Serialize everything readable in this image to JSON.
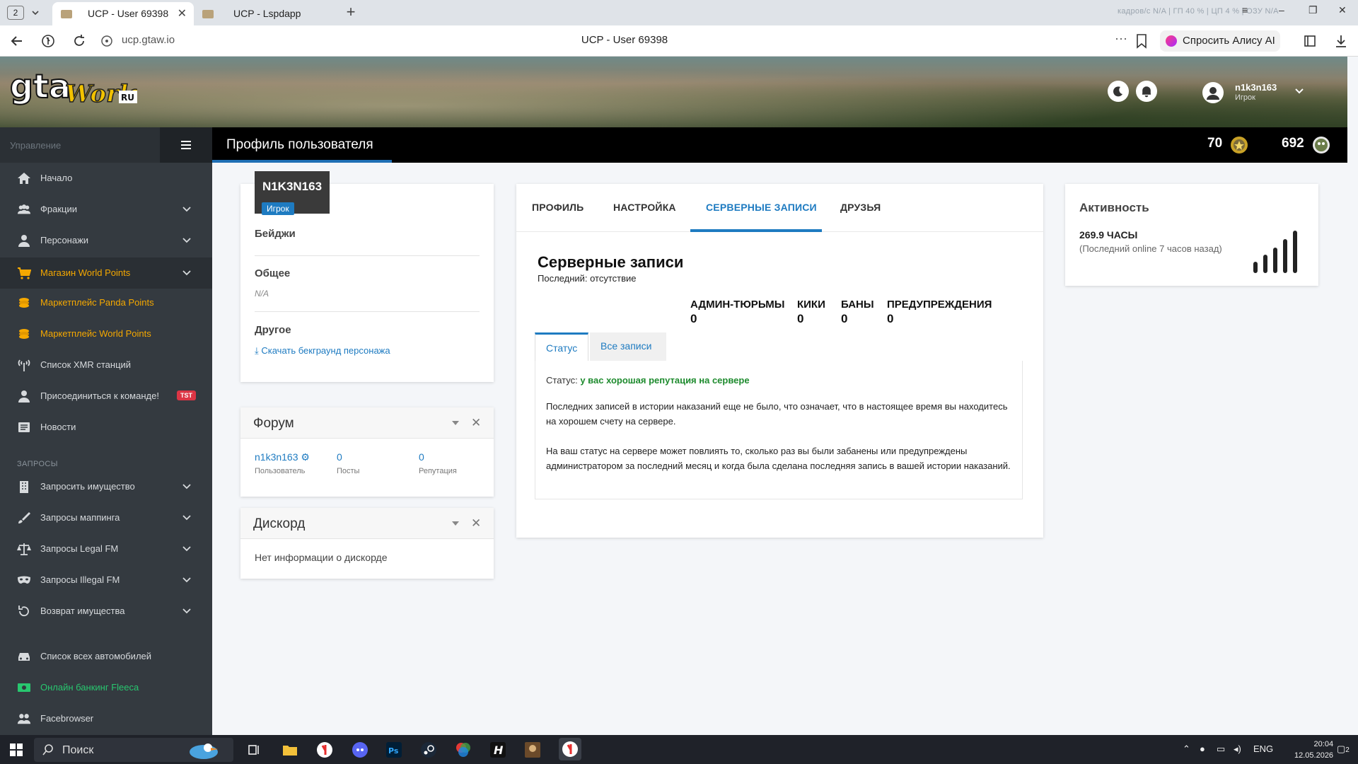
{
  "browser": {
    "tab_count": "2",
    "tabs": [
      {
        "title": "UCP - User 69398"
      },
      {
        "title": "UCP - Lspdapp"
      }
    ],
    "sys_overlay": "кадров/с  N/A   |  ГП  40 %  |  ЦП  4 %  |  ОЗУ  N/A",
    "url": "ucp.gtaw.io",
    "page_title": "UCP - User 69398",
    "alice_label": "Спросить Алису AI"
  },
  "header": {
    "logo_text": "gtaWorld.ru",
    "user_name": "n1k3n163",
    "user_role": "Игрок"
  },
  "sidebar": {
    "section_label": "Управление",
    "items": [
      {
        "label": "Начало",
        "icon": "home-icon"
      },
      {
        "label": "Фракции",
        "icon": "users-icon"
      },
      {
        "label": "Персонажи",
        "icon": "user-icon"
      },
      {
        "label": "Магазин World Points",
        "icon": "cart-icon"
      },
      {
        "label": "Маркетплейс Panda Points",
        "icon": "coins-icon"
      },
      {
        "label": "Маркетплейс World Points",
        "icon": "coins-icon"
      },
      {
        "label": "Список XMR станций",
        "icon": "antenna-icon"
      },
      {
        "label": "Присоединиться к команде!",
        "icon": "user-plus-icon",
        "badge": "TST"
      },
      {
        "label": "Новости",
        "icon": "newspaper-icon"
      }
    ],
    "group_label": "ЗАПРОСЫ",
    "requests": [
      {
        "label": "Запросить имущество",
        "icon": "building-icon"
      },
      {
        "label": "Запросы маппинга",
        "icon": "brush-icon"
      },
      {
        "label": "Запросы Legal FM",
        "icon": "scale-icon"
      },
      {
        "label": "Запросы Illegal FM",
        "icon": "mask-icon"
      },
      {
        "label": "Возврат имущества",
        "icon": "undo-icon"
      }
    ],
    "bottom": [
      {
        "label": "Список всех автомобилей",
        "icon": "car-icon"
      },
      {
        "label": "Онлайн банкинг Fleeca",
        "icon": "money-icon"
      },
      {
        "label": "Facebrowser",
        "icon": "users-icon"
      }
    ]
  },
  "titlebar": {
    "title": "Профиль пользователя",
    "points_1": "70",
    "points_2": "692"
  },
  "profile": {
    "nickname": "N1K3N163",
    "role": "Игрок",
    "badges_label": "Бейджи",
    "general_label": "Общее",
    "general_value": "N/A",
    "other_label": "Другое",
    "download_link": "Скачать бекграунд персонажа"
  },
  "forum": {
    "title": "Форум",
    "username": "n1k3n163",
    "username_label": "Пользователь",
    "posts": "0",
    "posts_label": "Посты",
    "reputation": "0",
    "reputation_label": "Репутация"
  },
  "discord": {
    "title": "Дискорд",
    "text": "Нет информации о дискорде"
  },
  "records": {
    "tabs": [
      "ПРОФИЛЬ",
      "НАСТРОЙКА",
      "СЕРВЕРНЫЕ ЗАПИСИ",
      "ДРУЗЬЯ"
    ],
    "title": "Серверные записи",
    "subtitle": "Последний: отсутствие",
    "stats": [
      {
        "label": "АДМИН-ТЮРЬМЫ",
        "value": "0"
      },
      {
        "label": "КИКИ",
        "value": "0"
      },
      {
        "label": "БАНЫ",
        "value": "0"
      },
      {
        "label": "ПРЕДУПРЕЖДЕНИЯ",
        "value": "0"
      }
    ],
    "panel_tabs": [
      "Статус",
      "Все записи"
    ],
    "status_prefix": "Статус:",
    "status_value": "у вас хорошая репутация на сервере",
    "para1": "Последних записей в истории наказаний еще не было, что означает, что в настоящее время вы находитесь на хорошем счету на сервере.",
    "para2": "На ваш статус на сервере может повлиять то, сколько раз вы были забанены или предупреждены администратором за последний месяц и когда была сделана последняя запись в вашей истории наказаний."
  },
  "activity": {
    "title": "Активность",
    "hours": "269.9 ЧАСЫ",
    "last_online": "(Последний online 7 часов назад)"
  },
  "taskbar": {
    "search_label": "Поиск",
    "lang": "ENG",
    "time": "20:04",
    "date": "12.05.2026",
    "notif_count": "2"
  },
  "colors": {
    "accent": "#1e7bc1",
    "sidebar_bg": "#343a40",
    "gold": "#f5a800",
    "green": "#28c76f",
    "status_green": "#1e8b2e"
  }
}
